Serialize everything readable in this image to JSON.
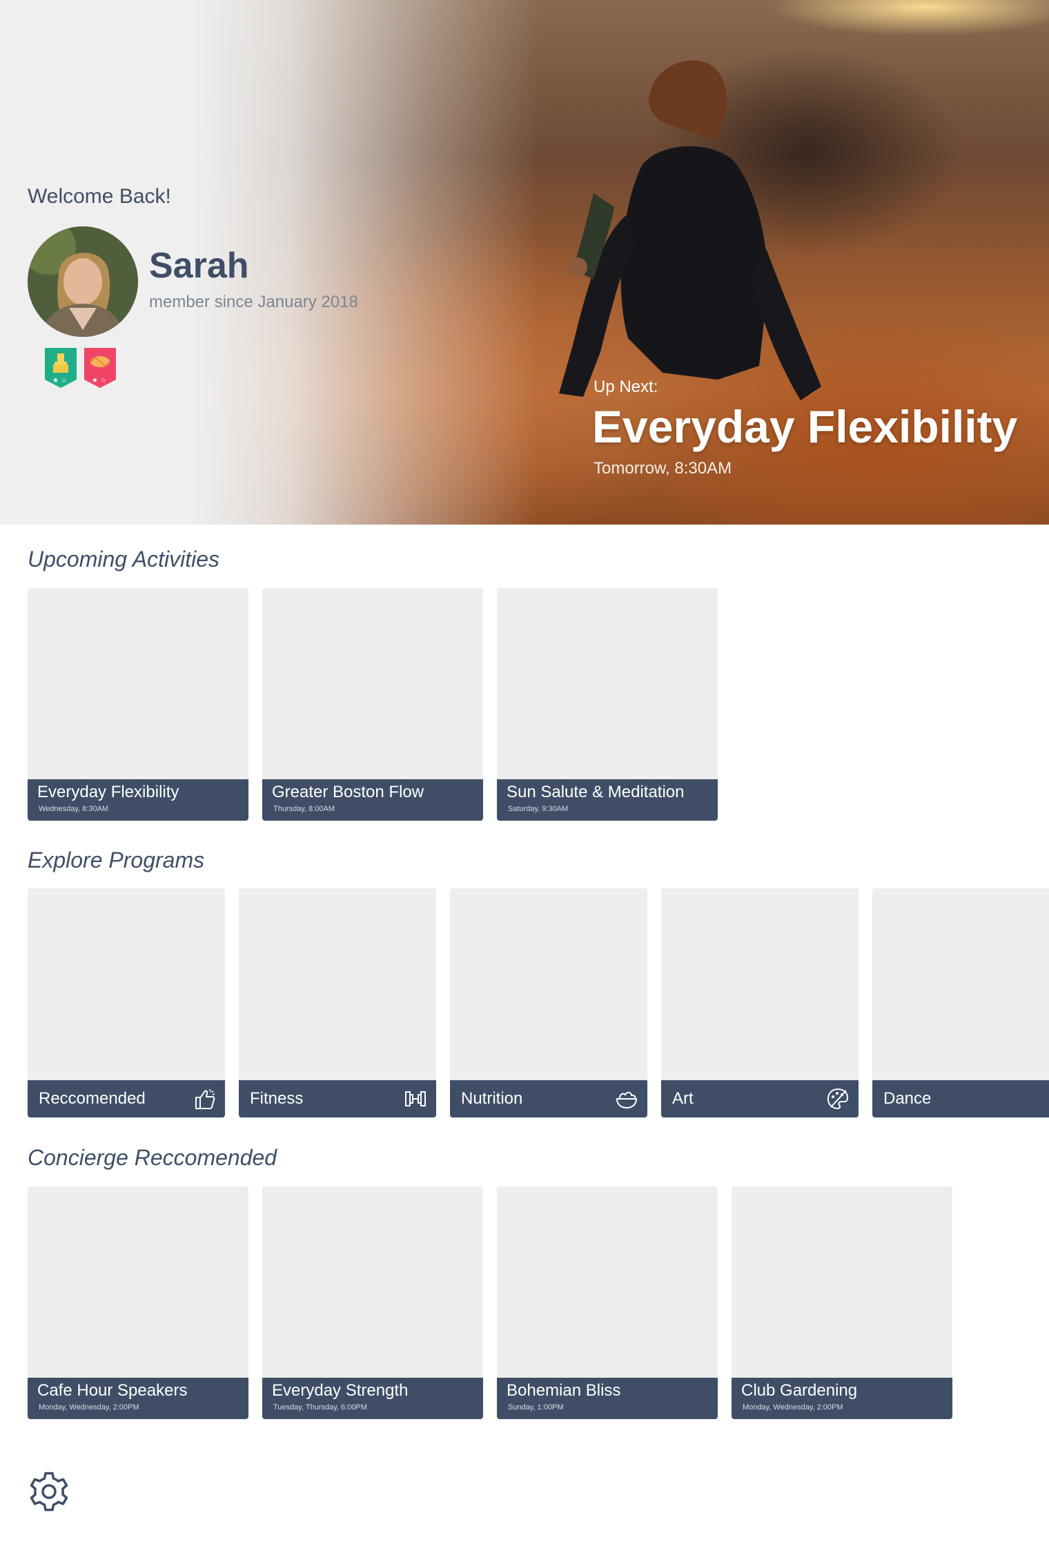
{
  "hero": {
    "welcome": "Welcome Back!",
    "user_name": "Sarah",
    "member_since": "member since January 2018",
    "badges": [
      "trophy-badge-icon",
      "handshake-badge-icon"
    ],
    "up_next": {
      "label": "Up Next:",
      "title": "Everyday Flexibility",
      "time": "Tomorrow, 8:30AM"
    }
  },
  "upcoming": {
    "title": "Upcoming Activities",
    "items": [
      {
        "title": "Everyday Flexibility",
        "time": "Wednesday, 8:30AM"
      },
      {
        "title": "Greater Boston Flow",
        "time": "Thursday, 8:00AM"
      },
      {
        "title": "Sun Salute & Meditation",
        "time": "Saturday, 9:30AM"
      }
    ]
  },
  "programs": {
    "title": "Explore Programs",
    "items": [
      {
        "title": "Reccomended",
        "icon": "thumbs-up-icon"
      },
      {
        "title": "Fitness",
        "icon": "dumbbell-icon"
      },
      {
        "title": "Nutrition",
        "icon": "salad-bowl-icon"
      },
      {
        "title": "Art",
        "icon": "paint-palette-icon"
      },
      {
        "title": "Dance",
        "icon": "dance-icon"
      }
    ]
  },
  "concierge": {
    "title": "Concierge Reccomended",
    "items": [
      {
        "title": "Cafe Hour Speakers",
        "time": "Monday, Wednesday, 2:00PM"
      },
      {
        "title": "Everyday Strength",
        "time": "Tuesday, Thursday, 6:00PM"
      },
      {
        "title": "Bohemian Bliss",
        "time": "Sunday, 1:00PM"
      },
      {
        "title": "Club Gardening",
        "time": "Monday, Wednesday, 2:00PM"
      }
    ]
  },
  "colors": {
    "accent": "#3f4e66",
    "card_placeholder": "#eeeeee",
    "badge_green": "#1fae8a",
    "badge_red": "#ef4466"
  },
  "footer": {
    "settings_icon": "gear-icon"
  }
}
